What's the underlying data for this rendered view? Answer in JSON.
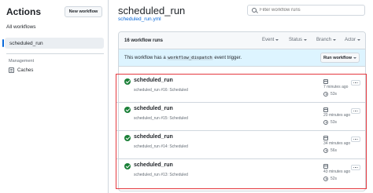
{
  "sidebar": {
    "title": "Actions",
    "new_workflow_label": "New workflow",
    "all_workflows_label": "All workflows",
    "selected_workflow_label": "scheduled_run",
    "management_heading": "Management",
    "caches_label": "Caches"
  },
  "header": {
    "title": "scheduled_run",
    "file_link": "scheduled_run.yml",
    "search_placeholder": "Filter workflow runs"
  },
  "runs": {
    "count_label": "16 workflow runs",
    "filters": [
      "Event",
      "Status",
      "Branch",
      "Actor"
    ],
    "dispatch_prefix": "This workflow has a",
    "dispatch_code": "workflow_dispatch",
    "dispatch_suffix": "event trigger.",
    "run_workflow_label": "Run workflow",
    "items": [
      {
        "name": "scheduled_run",
        "meta": "scheduled_run #16: Scheduled",
        "ago": "7 minutes ago",
        "duration": "53s"
      },
      {
        "name": "scheduled_run",
        "meta": "scheduled_run #15: Scheduled",
        "ago": "20 minutes ago",
        "duration": "53s"
      },
      {
        "name": "scheduled_run",
        "meta": "scheduled_run #14: Scheduled",
        "ago": "34 minutes ago",
        "duration": "56s"
      },
      {
        "name": "scheduled_run",
        "meta": "scheduled_run #13: Scheduled",
        "ago": "43 minutes ago",
        "duration": "52s"
      }
    ]
  },
  "colors": {
    "success": "#1a7f37",
    "highlight": "#e5393f",
    "accent": "#0969da"
  }
}
